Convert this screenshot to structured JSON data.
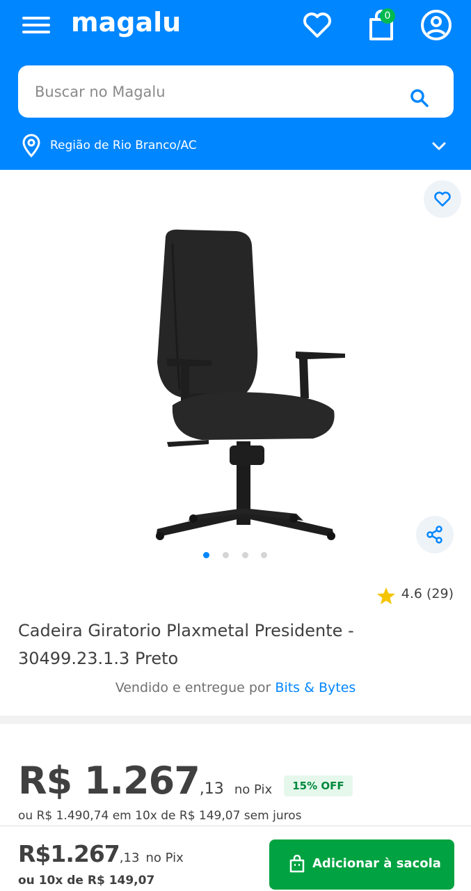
{
  "header": {
    "logo_text": "magalu",
    "cart_count": "0",
    "search_placeholder": "Buscar no Magalu",
    "region_label": "Região de Rio Branco/AC",
    "brand_color": "#0086ff"
  },
  "product": {
    "title": "Cadeira Giratorio Plaxmetal Presidente - 30499.23.1.3 Preto",
    "rating": "4.6 (29)",
    "seller_prefix": "Vendido e entregue por",
    "seller_name": "Bits & Bytes",
    "gallery_count": 4,
    "gallery_active": 1
  },
  "price": {
    "currency_int": "R$ 1.267",
    "cents": ",13",
    "method": "no Pix",
    "discount_badge": "15% OFF",
    "installments": "ou R$ 1.490,74 em 10x de R$ 149,07 sem juros"
  },
  "bottom_bar": {
    "price_int": "R$1.267",
    "cents": ",13",
    "method": "no Pix",
    "installments": "ou 10x de R$ 149,07",
    "add_button_label": "Adicionar à sacola",
    "button_color": "#00a241"
  },
  "icons": [
    "menu-icon",
    "heart-icon",
    "cart-icon",
    "user-icon",
    "search-icon",
    "location-pin-icon",
    "chevron-down-icon",
    "share-icon",
    "star-icon",
    "bag-icon"
  ]
}
